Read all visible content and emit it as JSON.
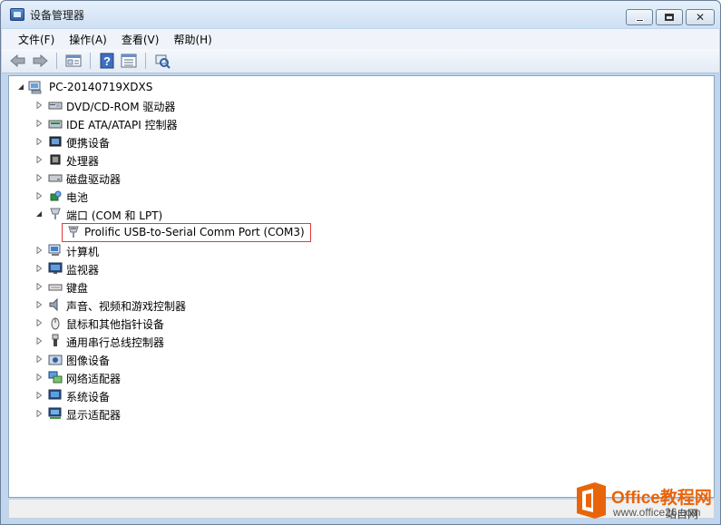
{
  "window": {
    "title": "设备管理器",
    "minimize_label": "",
    "maximize_label": "",
    "close_label": "✕"
  },
  "menu": [
    {
      "label": "文件(F)"
    },
    {
      "label": "操作(A)"
    },
    {
      "label": "查看(V)"
    },
    {
      "label": "帮助(H)"
    }
  ],
  "toolbar": {
    "buttons": [
      "back-icon",
      "forward-icon",
      "properties-icon",
      "help-icon",
      "view-icon",
      "scan-hardware-icon"
    ]
  },
  "tree": {
    "root": "PC-20140719XDXS",
    "categories": [
      {
        "label": "DVD/CD-ROM 驱动器",
        "icon": "dvd-drive-icon",
        "expanded": false
      },
      {
        "label": "IDE ATA/ATAPI 控制器",
        "icon": "ide-controller-icon",
        "expanded": false
      },
      {
        "label": "便携设备",
        "icon": "portable-device-icon",
        "expanded": false
      },
      {
        "label": "处理器",
        "icon": "processor-icon",
        "expanded": false
      },
      {
        "label": "磁盘驱动器",
        "icon": "disk-drive-icon",
        "expanded": false
      },
      {
        "label": "电池",
        "icon": "battery-icon",
        "expanded": false
      },
      {
        "label": "端口 (COM 和 LPT)",
        "icon": "port-icon",
        "expanded": true
      },
      {
        "label": "计算机",
        "icon": "computer-icon",
        "expanded": false
      },
      {
        "label": "监视器",
        "icon": "monitor-icon",
        "expanded": false
      },
      {
        "label": "键盘",
        "icon": "keyboard-icon",
        "expanded": false
      },
      {
        "label": "声音、视频和游戏控制器",
        "icon": "sound-icon",
        "expanded": false
      },
      {
        "label": "鼠标和其他指针设备",
        "icon": "mouse-icon",
        "expanded": false
      },
      {
        "label": "通用串行总线控制器",
        "icon": "usb-icon",
        "expanded": false
      },
      {
        "label": "图像设备",
        "icon": "imaging-icon",
        "expanded": false
      },
      {
        "label": "网络适配器",
        "icon": "network-adapter-icon",
        "expanded": false
      },
      {
        "label": "系统设备",
        "icon": "system-device-icon",
        "expanded": false
      },
      {
        "label": "显示适配器",
        "icon": "display-adapter-icon",
        "expanded": false
      }
    ],
    "port_child": "Prolific USB-to-Serial Comm Port (COM3)"
  },
  "watermark": {
    "brand": "Office教程网",
    "url": "www.office26.com",
    "corner": "站自网"
  },
  "colors": {
    "accent": "#e23a3a",
    "watermark_orange": "#e8640a"
  }
}
